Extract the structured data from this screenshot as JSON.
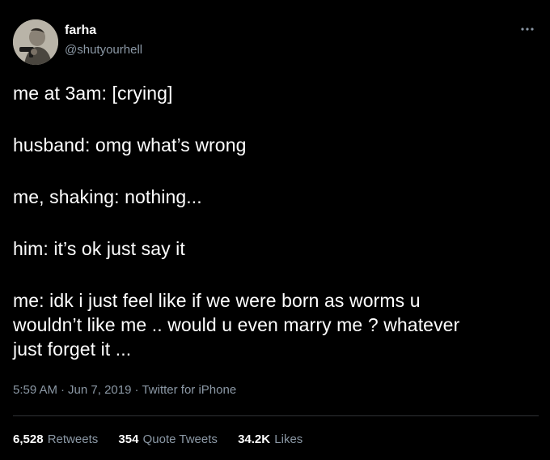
{
  "tweet": {
    "author": {
      "display_name": "farha",
      "handle": "@shutyourhell",
      "avatar_icon": "avatar-photo"
    },
    "more_icon": "ellipsis-icon",
    "text_lines": [
      "me at 3am: [crying]",
      "husband: omg what’s wrong",
      "me, shaking: nothing...",
      "him: it’s ok just say it",
      "me: idk i just feel like if we were born as worms u\nwouldn’t like me .. would u even marry me ? whatever\njust forget it ..."
    ],
    "time": "5:59 AM",
    "date": "Jun 7, 2019",
    "separator": "·",
    "source": "Twitter for iPhone",
    "stats": {
      "retweets": {
        "count": "6,528",
        "label": "Retweets"
      },
      "quote_tweets": {
        "count": "354",
        "label": "Quote Tweets"
      },
      "likes": {
        "count": "34.2K",
        "label": "Likes"
      }
    }
  },
  "colors": {
    "background": "#000000",
    "text": "#ffffff",
    "secondary_text": "#8b98a5",
    "divider": "#2f3336"
  }
}
